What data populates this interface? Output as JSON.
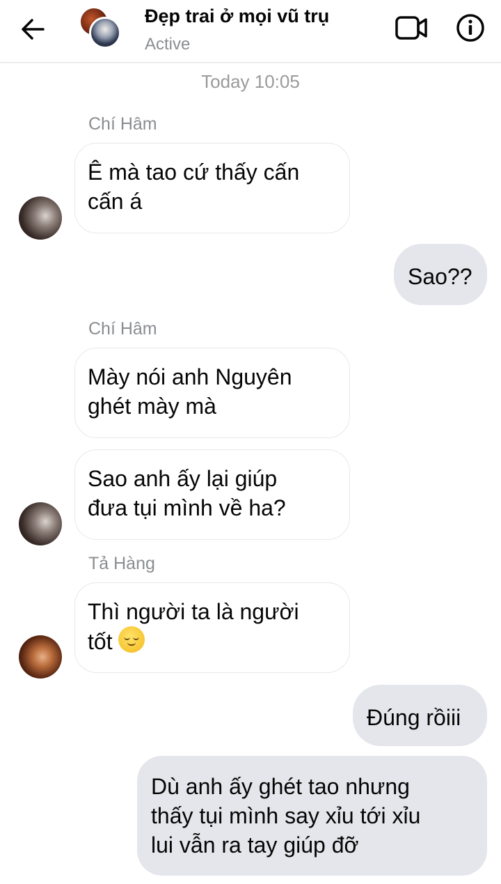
{
  "header": {
    "title": "Đẹp trai ở mọi vũ trụ",
    "status": "Active",
    "back_icon": "arrow-left-icon",
    "video_icon": "video-camera-icon",
    "info_icon": "info-icon"
  },
  "conversation": {
    "timestamp": "Today 10:05",
    "messages": [
      {
        "direction": "incoming",
        "sender": "Chí Hâm",
        "lines": [
          "Ê mà tao cứ thấy cấn",
          "cấn á"
        ]
      },
      {
        "direction": "outgoing",
        "lines": [
          "Sao??"
        ]
      },
      {
        "direction": "incoming",
        "sender": "Chí Hâm",
        "lines": [
          "Mày nói anh Nguyên",
          "ghét mày mà"
        ]
      },
      {
        "direction": "incoming",
        "lines": [
          "Sao anh ấy lại giúp",
          "đưa tụi mình về ha?"
        ]
      },
      {
        "direction": "incoming",
        "sender": "Tả Hàng",
        "lines": [
          "Thì người ta là người",
          "tốt"
        ],
        "emoji": "relieved-face"
      },
      {
        "direction": "outgoing",
        "lines": [
          "Đúng rồiii"
        ]
      },
      {
        "direction": "outgoing",
        "lines": [
          "Dù anh ấy ghét tao nhưng",
          "thấy tụi mình say xỉu tới xỉu",
          "lui vẫn ra tay giúp đỡ"
        ]
      }
    ]
  },
  "colors": {
    "incoming_bubble_border": "#e7e8ea",
    "outgoing_bubble_bg": "#e4e6eb",
    "meta_text": "#8a8d91"
  }
}
